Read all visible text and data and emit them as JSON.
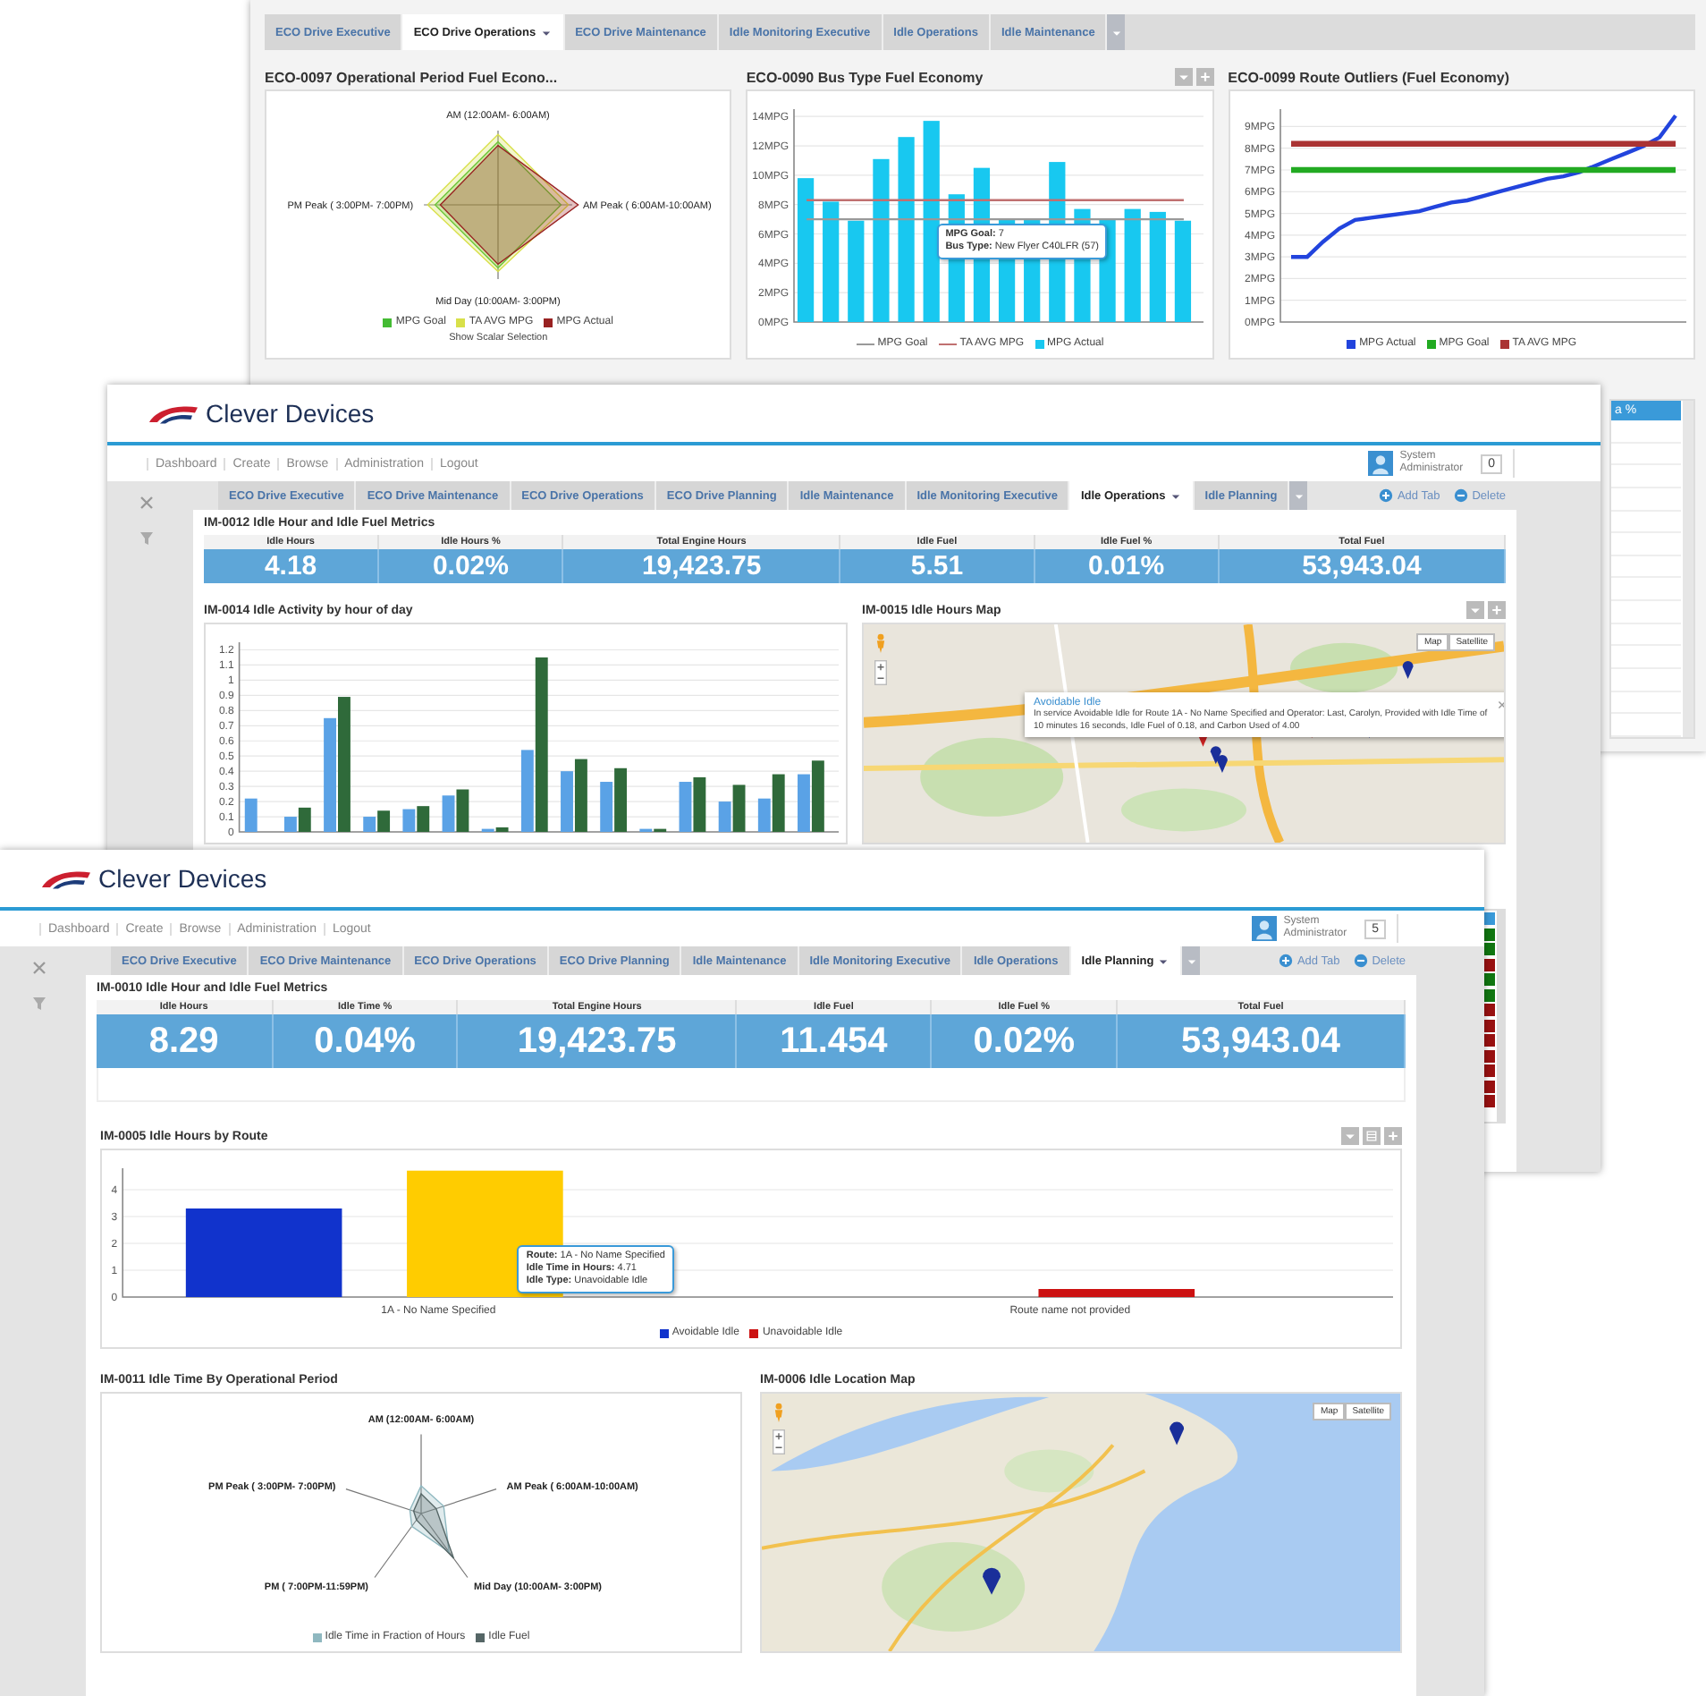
{
  "windows": [
    {
      "tabs": [
        {
          "label": "ECO Drive Executive",
          "selected": false
        },
        {
          "label": "ECO Drive Operations",
          "selected": true
        },
        {
          "label": "ECO Drive Maintenance",
          "selected": false
        },
        {
          "label": "Idle Monitoring Executive",
          "selected": false
        },
        {
          "label": "Idle Operations",
          "selected": false
        },
        {
          "label": "Idle Maintenance",
          "selected": false
        }
      ],
      "rows": [
        [
          {
            "kind": "radar",
            "title": "ECO-0097 Operational Period Fuel Econo...",
            "axes": [
              "AM (12:00AM- 6:00AM)",
              "AM Peak ( 6:00AM-10:00AM)",
              "Mid Day (10:00AM- 3:00PM)",
              "PM Peak ( 3:00PM- 7:00PM)"
            ],
            "legend": [
              {
                "label": "MPG Goal",
                "color": "#44bb33"
              },
              {
                "label": "TA AVG MPG",
                "color": "#d8e04a"
              },
              {
                "label": "MPG Actual",
                "color": "#992222"
              }
            ],
            "footer": "Show Scalar Selection"
          },
          {
            "kind": "bar",
            "title": "ECO-0090 Bus Type Fuel Economy",
            "toolbar": true,
            "chart_data": {
              "type": "bar",
              "grid": true,
              "legend": "bottom",
              "ylim": [
                0,
                14.5
              ],
              "yticks": [
                {
                  "value": 0,
                  "label": "0MPG"
                },
                {
                  "value": 2,
                  "label": "2MPG"
                },
                {
                  "value": 4,
                  "label": "4MPG"
                },
                {
                  "value": 6,
                  "label": "6MPG"
                },
                {
                  "value": 8,
                  "label": "8MPG"
                },
                {
                  "value": 10,
                  "label": "10MPG"
                },
                {
                  "value": 12,
                  "label": "12MPG"
                },
                {
                  "value": 14,
                  "label": "14MPG"
                }
              ],
              "series": [
                {
                  "name": "MPG Goal",
                  "type": "line",
                  "color": "#999999",
                  "values": [
                    7,
                    7,
                    7,
                    7,
                    7,
                    7,
                    7,
                    7,
                    7,
                    7,
                    7,
                    7,
                    7,
                    7,
                    7,
                    7
                  ]
                },
                {
                  "name": "TA AVG MPG",
                  "type": "line",
                  "color": "#c07070",
                  "values": [
                    8.3,
                    8.3,
                    8.3,
                    8.3,
                    8.3,
                    8.3,
                    8.3,
                    8.3,
                    8.3,
                    8.3,
                    8.3,
                    8.3,
                    8.3,
                    8.3,
                    8.3,
                    8.3
                  ]
                },
                {
                  "name": "MPG Actual",
                  "type": "bar",
                  "color": "#18c8f0",
                  "values": [
                    9.8,
                    8.2,
                    6.9,
                    11.1,
                    12.6,
                    13.7,
                    8.7,
                    10.5,
                    7,
                    7,
                    10.9,
                    7.7,
                    7,
                    7.7,
                    7.5,
                    6.9
                  ]
                }
              ]
            },
            "tooltip": {
              "lines": [
                "**MPG Goal:** 7",
                "**Bus Type:** New Flyer C40LFR (57)"
              ]
            }
          },
          {
            "kind": "line",
            "title": "ECO-0099 Route Outliers (Fuel Economy)",
            "chart_data": {
              "type": "line",
              "grid": true,
              "legend": "bottom",
              "ylim": [
                0,
                9.8
              ],
              "yticks": [
                {
                  "value": 0,
                  "label": "0MPG"
                },
                {
                  "value": 1,
                  "label": "1MPG"
                },
                {
                  "value": 2,
                  "label": "2MPG"
                },
                {
                  "value": 3,
                  "label": "3MPG"
                },
                {
                  "value": 4,
                  "label": "4MPG"
                },
                {
                  "value": 5,
                  "label": "5MPG"
                },
                {
                  "value": 6,
                  "label": "6MPG"
                },
                {
                  "value": 7,
                  "label": "7MPG"
                },
                {
                  "value": 8,
                  "label": "8MPG"
                },
                {
                  "value": 9,
                  "label": "9MPG"
                }
              ],
              "series": [
                {
                  "name": "MPG Actual",
                  "color": "#2244dd",
                  "values": [
                    3,
                    3,
                    3.7,
                    4.3,
                    4.7,
                    4.8,
                    4.9,
                    5,
                    5.1,
                    5.3,
                    5.5,
                    5.6,
                    5.8,
                    6,
                    6.2,
                    6.4,
                    6.6,
                    6.7,
                    6.9,
                    7.2,
                    7.5,
                    7.8,
                    8.1,
                    8.5,
                    9.5
                  ]
                },
                {
                  "name": "MPG Goal",
                  "color": "#22aa22",
                  "values": [
                    7,
                    7,
                    7,
                    7,
                    7,
                    7,
                    7,
                    7,
                    7,
                    7,
                    7,
                    7,
                    7,
                    7,
                    7,
                    7,
                    7,
                    7,
                    7,
                    7,
                    7,
                    7,
                    7,
                    7,
                    7
                  ]
                },
                {
                  "name": "TA AVG MPG",
                  "color": "#aa3333",
                  "values": [
                    8.2,
                    8.2,
                    8.2,
                    8.2,
                    8.2,
                    8.2,
                    8.2,
                    8.2,
                    8.2,
                    8.2,
                    8.2,
                    8.2,
                    8.2,
                    8.2,
                    8.2,
                    8.2,
                    8.2,
                    8.2,
                    8.2,
                    8.2,
                    8.2,
                    8.2,
                    8.2,
                    8.2,
                    8.2
                  ]
                }
              ]
            }
          }
        ],
        [
          {
            "kind": "table",
            "header": "a %"
          }
        ]
      ]
    },
    {
      "header": {
        "brand": "Clever Devices",
        "nav": [
          "Dashboard",
          "Create",
          "Browse",
          "Administration",
          "Logout"
        ],
        "user": {
          "name": "System",
          "role": "Administrator",
          "count": "0"
        }
      },
      "tabs": [
        {
          "label": "ECO Drive Executive",
          "selected": false
        },
        {
          "label": "ECO Drive Maintenance",
          "selected": false
        },
        {
          "label": "ECO Drive Operations",
          "selected": false
        },
        {
          "label": "ECO Drive Planning",
          "selected": false
        },
        {
          "label": "Idle Maintenance",
          "selected": false
        },
        {
          "label": "Idle Monitoring Executive",
          "selected": false
        },
        {
          "label": "Idle Operations",
          "selected": true
        },
        {
          "label": "Idle Planning",
          "selected": false
        }
      ],
      "actions": [
        "Add Tab",
        "Delete"
      ],
      "metrics": {
        "title": "IM-0012 Idle Hour and Idle Fuel Metrics",
        "items": [
          {
            "label": "Idle Hours",
            "value": "4.18"
          },
          {
            "label": "Idle Hours %",
            "value": "0.02%"
          },
          {
            "label": "Total Engine Hours",
            "value": "19,423.75"
          },
          {
            "label": "Idle Fuel",
            "value": "5.51"
          },
          {
            "label": "Idle Fuel %",
            "value": "0.01%"
          },
          {
            "label": "Total Fuel",
            "value": "53,943.04"
          }
        ]
      },
      "rows": [
        [
          {
            "kind": "bar",
            "title": "IM-0014 Idle Activity by hour of day",
            "chart_data": {
              "type": "bar",
              "grid": true,
              "ylim": [
                0,
                1.25
              ],
              "yticks": [
                {
                  "value": 0,
                  "label": "0"
                },
                {
                  "value": 0.1,
                  "label": "0.1"
                },
                {
                  "value": 0.2,
                  "label": "0.2"
                },
                {
                  "value": 0.3,
                  "label": "0.3"
                },
                {
                  "value": 0.4,
                  "label": "0.4"
                },
                {
                  "value": 0.5,
                  "label": "0.5"
                },
                {
                  "value": 0.6,
                  "label": "0.6"
                },
                {
                  "value": 0.7,
                  "label": "0.7"
                },
                {
                  "value": 0.8,
                  "label": "0.8"
                },
                {
                  "value": 0.9,
                  "label": "0.9"
                },
                {
                  "value": 1,
                  "label": "1"
                },
                {
                  "value": 1.1,
                  "label": "1.1"
                },
                {
                  "value": 1.2,
                  "label": "1.2"
                }
              ],
              "series": [
                {
                  "type": "bar",
                  "color": "#5aa2e6",
                  "values": [
                    0.22,
                    0.1,
                    0.75,
                    0.1,
                    0.15,
                    0.24,
                    0.02,
                    0.54,
                    0.4,
                    0.33,
                    0.02,
                    0.33,
                    0.2,
                    0.22,
                    0.38
                  ]
                },
                {
                  "type": "bar",
                  "color": "#2f6a3a",
                  "values": [
                    null,
                    0.16,
                    0.89,
                    0.14,
                    0.17,
                    0.28,
                    0.03,
                    1.15,
                    0.48,
                    0.42,
                    0.02,
                    0.36,
                    0.31,
                    0.38,
                    0.47
                  ]
                }
              ]
            }
          },
          {
            "kind": "map",
            "title": "IM-0015 Idle Hours Map",
            "toolbar": true,
            "buttons": [
              "Map",
              "Satellite"
            ],
            "popup": {
              "title": "Avoidable Idle",
              "text": "In service Avoidable Idle for Route 1A - No Name Specified and Operator: Last, Carolyn, Provided with Idle Time of 10 minutes 16 seconds, Idle Fuel of 0.18, and Carbon Used of 4.00"
            }
          }
        ],
        [
          {
            "kind": "status_list",
            "items": [
              {
                "color": "#3a9ad9"
              },
              {
                "color": "#117711"
              },
              {
                "color": "#117711"
              },
              {
                "color": "#991111"
              },
              {
                "color": "#117711"
              },
              {
                "color": "#117711"
              },
              {
                "color": "#991111"
              },
              {
                "color": "#991111"
              },
              {
                "color": "#991111"
              },
              {
                "color": "#991111"
              },
              {
                "color": "#991111"
              },
              {
                "color": "#991111"
              },
              {
                "color": "#991111"
              }
            ]
          }
        ]
      ]
    },
    {
      "header": {
        "brand": "Clever Devices",
        "nav": [
          "Dashboard",
          "Create",
          "Browse",
          "Administration",
          "Logout"
        ],
        "user": {
          "name": "System",
          "role": "Administrator",
          "count": "5"
        }
      },
      "tabs": [
        {
          "label": "ECO Drive Executive",
          "selected": false
        },
        {
          "label": "ECO Drive Maintenance",
          "selected": false
        },
        {
          "label": "ECO Drive Operations",
          "selected": false
        },
        {
          "label": "ECO Drive Planning",
          "selected": false
        },
        {
          "label": "Idle Maintenance",
          "selected": false
        },
        {
          "label": "Idle Monitoring Executive",
          "selected": false
        },
        {
          "label": "Idle Operations",
          "selected": false
        },
        {
          "label": "Idle Planning",
          "selected": true
        }
      ],
      "actions": [
        "Add Tab",
        "Delete"
      ],
      "metrics": {
        "title": "IM-0010 Idle Hour and Idle Fuel Metrics",
        "items": [
          {
            "label": "Idle Hours",
            "value": "8.29"
          },
          {
            "label": "Idle Time %",
            "value": "0.04%"
          },
          {
            "label": "Total Engine Hours",
            "value": "19,423.75"
          },
          {
            "label": "Idle Fuel",
            "value": "11.454"
          },
          {
            "label": "Idle Fuel %",
            "value": "0.02%"
          },
          {
            "label": "Total Fuel",
            "value": "53,943.04"
          }
        ]
      },
      "rows": [
        [
          {
            "kind": "bar",
            "title": "IM-0005 Idle Hours by Route",
            "toolbar": true,
            "chart_data": {
              "type": "bar",
              "grid": true,
              "legend": "bottom",
              "categories": [
                "1A - No Name Specified",
                "Route name not provided"
              ],
              "ylim": [
                0,
                4.8
              ],
              "yticks": [
                0,
                1,
                2,
                3,
                4
              ],
              "series": [
                {
                  "name": "Avoidable Idle",
                  "type": "bar",
                  "color": "#1133cc",
                  "values": [
                    3.3,
                    null
                  ]
                },
                {
                  "name": "Unavoidable Idle",
                  "type": "bar",
                  "color": "#cc1111",
                  "values": [
                    null,
                    0.3
                  ]
                },
                {
                  "type": "bar",
                  "color": "#ffcc00",
                  "values": [
                    4.71,
                    null
                  ]
                }
              ]
            },
            "tooltip": {
              "lines": [
                "**Route:** 1A - No Name Specified",
                "**Idle Time in Hours:** 4.71",
                "**Idle Type:** Unavoidable Idle"
              ]
            }
          }
        ],
        [
          {
            "kind": "radar",
            "title": "IM-0011 Idle Time By Operational Period",
            "axes": [
              "AM (12:00AM- 6:00AM)",
              "AM Peak ( 6:00AM-10:00AM)",
              "Mid Day (10:00AM- 3:00PM)",
              "PM ( 7:00PM-11:59PM)",
              "PM Peak ( 3:00PM- 7:00PM)"
            ],
            "legend": [
              {
                "label": "Idle Time in Fraction of Hours",
                "color": "#8fb8c0"
              },
              {
                "label": "Idle Fuel",
                "color": "#556666"
              }
            ]
          },
          {
            "kind": "map",
            "title": "IM-0006 Idle Location Map",
            "buttons": [
              "Map",
              "Satellite"
            ]
          }
        ]
      ]
    }
  ]
}
